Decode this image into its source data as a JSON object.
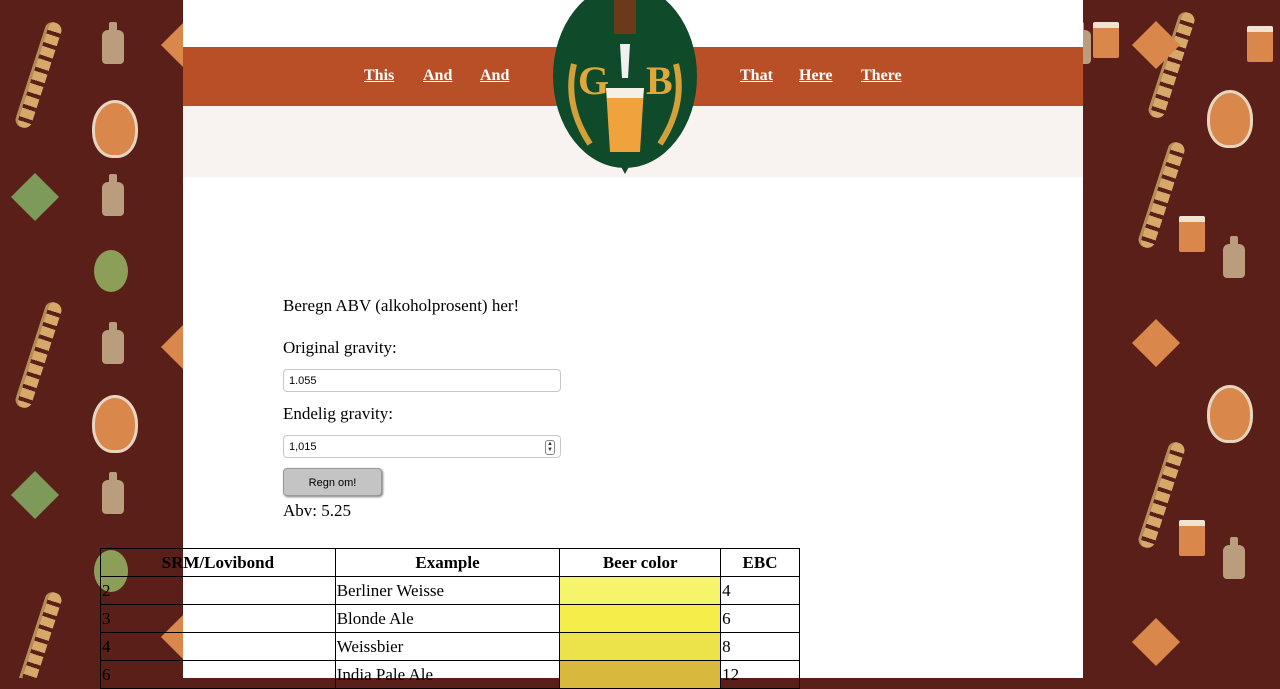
{
  "nav": {
    "left": [
      "This",
      "And",
      "And"
    ],
    "right": [
      "That",
      "Here",
      "There"
    ],
    "logo_letters": {
      "left": "G",
      "right": "B"
    }
  },
  "calculator": {
    "heading": "Beregn ABV (alkoholprosent) her!",
    "og_label": "Original gravity:",
    "og_value": "1.055",
    "fg_label": "Endelig gravity:",
    "fg_value": "1,015",
    "button": "Regn om!",
    "result": "Abv: 5.25"
  },
  "table": {
    "headers": [
      "SRM/Lovibond",
      "Example",
      "Beer color",
      "EBC"
    ],
    "rows": [
      {
        "srm": "2",
        "example": "Berliner Weisse",
        "color": "#f5f46a",
        "ebc": "4"
      },
      {
        "srm": "3",
        "example": "Blonde Ale",
        "color": "#f5ee4a",
        "ebc": "6"
      },
      {
        "srm": "4",
        "example": "Weissbier",
        "color": "#ece24a",
        "ebc": "8"
      },
      {
        "srm": "6",
        "example": "India Pale Ale",
        "color": "#d9b83e",
        "ebc": "12"
      }
    ]
  },
  "colors": {
    "background": "#5a1f18",
    "navbar": "#b84f26",
    "subband": "#f8f3f0"
  }
}
